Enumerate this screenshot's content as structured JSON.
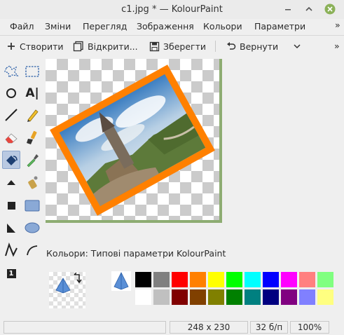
{
  "window": {
    "title": "c1.jpg * — KolourPaint"
  },
  "menu": [
    "Файл",
    "Зміни",
    "Перегляд",
    "Зображення",
    "Кольори",
    "Параметри"
  ],
  "toolbar": {
    "new_label": "Створити",
    "open_label": "Відкрити...",
    "save_label": "Зберегти",
    "undo_label": "Вернути",
    "overflow": "»"
  },
  "tools": [
    "free-form-selection",
    "rectangular-selection",
    "ellipse-selection",
    "text",
    "line",
    "pen",
    "eraser",
    "brush",
    "flood-fill",
    "color-picker",
    "color-eraser",
    "spraycan",
    "rectangle",
    "rounded-rectangle",
    "polygon",
    "ellipse",
    "polyline",
    "curve",
    "zoom-1"
  ],
  "tool_text_label": "A|",
  "tool_zoom_label": "1",
  "status_text": "Кольори: Типові параметри KolourPaint",
  "palette": {
    "row1": [
      "#000000",
      "#808080",
      "#ff0000",
      "#ff8000",
      "#ffff00",
      "#00ff00",
      "#00ffff",
      "#0000ff",
      "#ff00ff",
      "#ff8080",
      "#80ff80"
    ],
    "row2": [
      "#ffffff",
      "#c0c0c0",
      "#800000",
      "#804000",
      "#808000",
      "#008000",
      "#008080",
      "#000080",
      "#800080",
      "#8080ff",
      "#ffff80"
    ]
  },
  "statusbar": {
    "size": "248 x 230",
    "depth": "32 б/п",
    "zoom": "100%"
  },
  "colors": {
    "accent": "#b9c9e2",
    "canvas_border": "#8dac72",
    "frame": "#ff8000"
  }
}
